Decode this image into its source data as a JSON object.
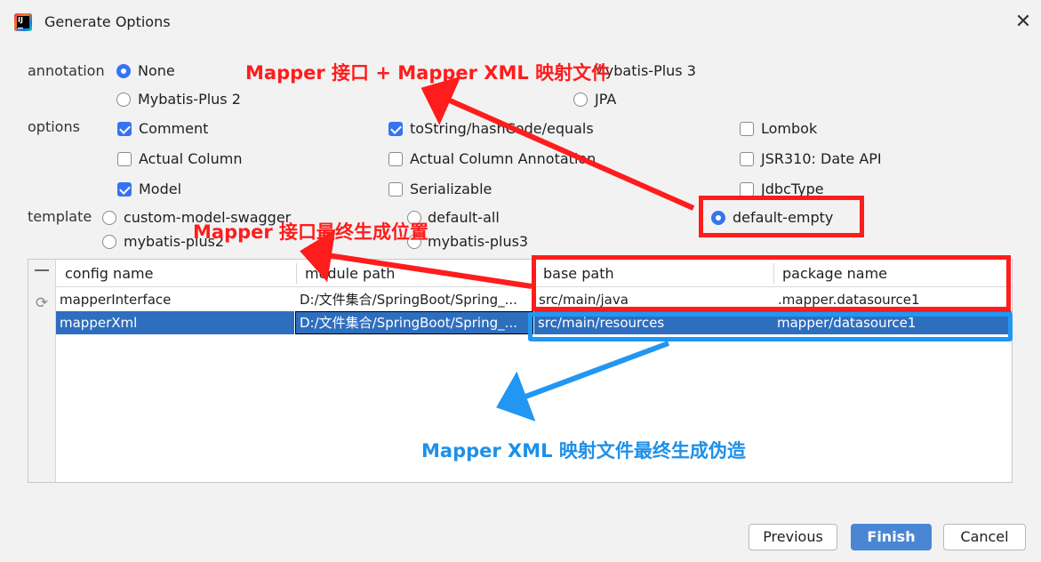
{
  "window": {
    "title": "Generate Options",
    "close_glyph": "✕"
  },
  "annotation": {
    "label": "annotation",
    "options": [
      {
        "label": "None",
        "selected": true
      },
      {
        "label": "Mybatis-Plus 2",
        "selected": false
      },
      {
        "label": "Mybatis-Plus 3",
        "selected": false
      },
      {
        "label": "JPA",
        "selected": false
      }
    ]
  },
  "options": {
    "label": "options",
    "items": [
      {
        "label": "Comment",
        "checked": true
      },
      {
        "label": "toString/hashCode/equals",
        "checked": true
      },
      {
        "label": "Lombok",
        "checked": false
      },
      {
        "label": "Actual Column",
        "checked": false
      },
      {
        "label": "Actual Column Annotation",
        "checked": false
      },
      {
        "label": "JSR310: Date API",
        "checked": false
      },
      {
        "label": "Model",
        "checked": true
      },
      {
        "label": "Serializable",
        "checked": false
      },
      {
        "label": "JdbcType",
        "checked": false
      }
    ]
  },
  "template": {
    "label": "template",
    "options": [
      {
        "label": "custom-model-swagger",
        "selected": false
      },
      {
        "label": "default-all",
        "selected": false
      },
      {
        "label": "default-empty",
        "selected": true
      },
      {
        "label": "mybatis-plus2",
        "selected": false
      },
      {
        "label": "mybatis-plus3",
        "selected": false
      }
    ]
  },
  "table": {
    "columns": [
      "config name",
      "module path",
      "base path",
      "package name"
    ],
    "rows": [
      {
        "config_name": "mapperInterface",
        "module_path": "D:/文件集合/SpringBoot/Spring_...",
        "base_path": "src/main/java",
        "package_name": ".mapper.datasource1",
        "selected": false
      },
      {
        "config_name": "mapperXml",
        "module_path": "D:/文件集合/SpringBoot/Spring_...",
        "base_path": "src/main/resources",
        "package_name": "mapper/datasource1",
        "selected": true
      }
    ],
    "tool_icons": [
      "minus-icon",
      "refresh-icon"
    ]
  },
  "annotations_overlay": {
    "top_red": "Mapper 接口 + Mapper XML 映射文件",
    "mid_red": "Mapper 接口最终生成位置",
    "bottom_blue": "Mapper XML 映射文件最终生成伪造",
    "colors": {
      "red": "#ff1c1c",
      "blue": "#2196f3"
    }
  },
  "buttons": {
    "previous": "Previous",
    "finish": "Finish",
    "cancel": "Cancel"
  },
  "colors": {
    "accent": "#3574f0",
    "selection": "#2e6ebf",
    "primary_button": "#4a86d4"
  }
}
